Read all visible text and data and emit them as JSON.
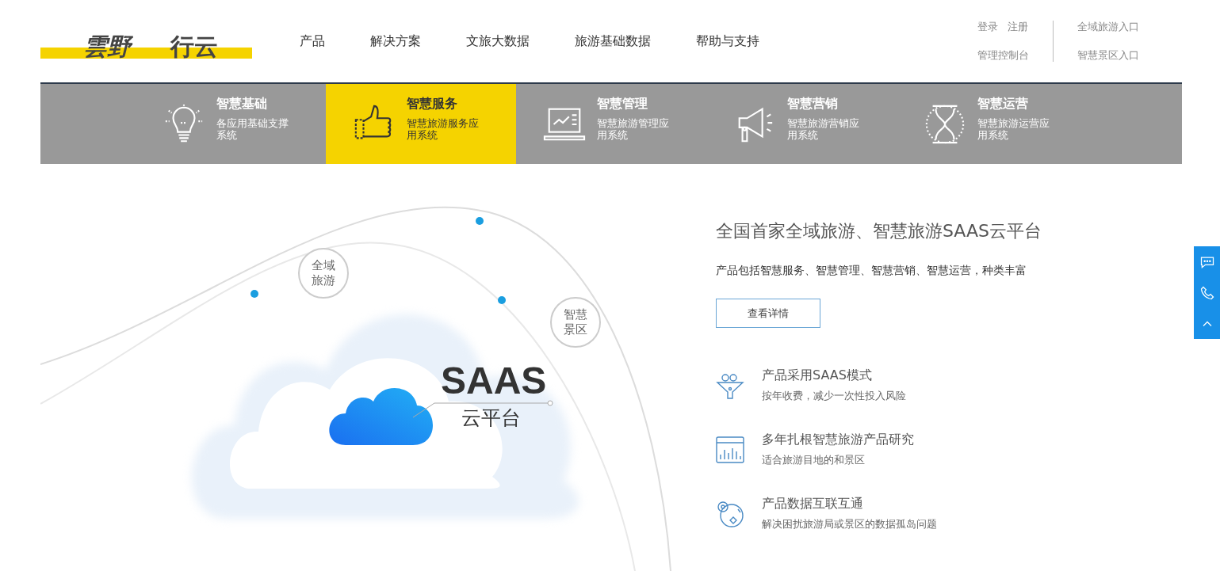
{
  "logo": {
    "text_1": "雲野",
    "text_2": "行云"
  },
  "nav": [
    {
      "label": "产品"
    },
    {
      "label": "解决方案"
    },
    {
      "label": "文旅大数据"
    },
    {
      "label": "旅游基础数据"
    },
    {
      "label": "帮助与支持"
    }
  ],
  "account_links": {
    "login": "登录",
    "register": "注册",
    "console": "管理控制台"
  },
  "portal_links": [
    "全域旅游入口",
    "智慧景区入口"
  ],
  "categories": [
    {
      "title": "智慧基础",
      "subtitle": "各应用基础支撑系统",
      "selected": false
    },
    {
      "title": "智慧服务",
      "subtitle": "智慧旅游服务应用系统",
      "selected": true
    },
    {
      "title": "智慧管理",
      "subtitle": "智慧旅游管理应用系统",
      "selected": false
    },
    {
      "title": "智慧营销",
      "subtitle": "智慧旅游营销应用系统",
      "selected": false
    },
    {
      "title": "智慧运营",
      "subtitle": "智慧旅游运营应用系统",
      "selected": false
    }
  ],
  "hero": {
    "bubbles": [
      "全域旅游",
      "智慧景区"
    ],
    "saas_title": "SAAS",
    "saas_subtitle": "云平台",
    "headline": "全国首家全域旅游、智慧旅游SAAS云平台",
    "description": "产品包括智慧服务、智慧管理、智慧营销、智慧运营，种类丰富",
    "button": "查看详情",
    "features": [
      {
        "title": "产品采用SAAS模式",
        "text": "按年收费，减少一次性投入风险"
      },
      {
        "title": "多年扎根智慧旅游产品研究",
        "text": "适合旅游目地的和景区"
      },
      {
        "title": "产品数据互联互通",
        "text": "解决困扰旅游局或景区的数据孤岛问题"
      }
    ]
  }
}
